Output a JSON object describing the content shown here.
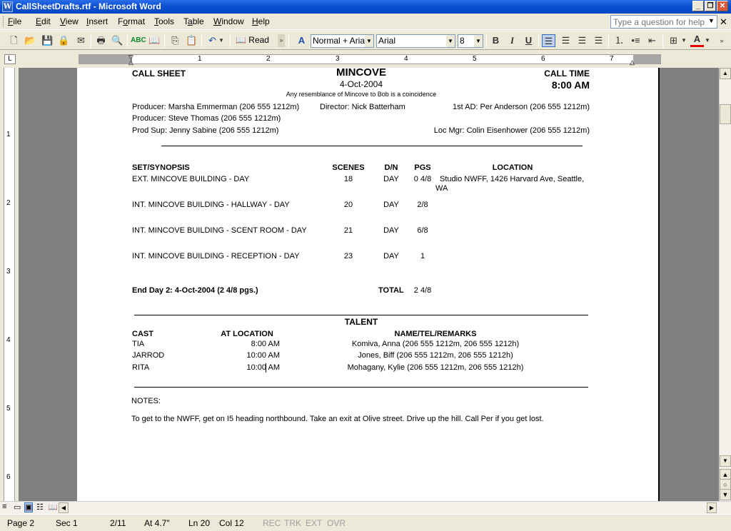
{
  "window": {
    "title": "CallSheetDrafts.rtf - Microsoft Word",
    "app_icon": "W"
  },
  "menu": [
    {
      "label": "File",
      "u": "F"
    },
    {
      "label": "Edit",
      "u": "E"
    },
    {
      "label": "View",
      "u": "V"
    },
    {
      "label": "Insert",
      "u": "I"
    },
    {
      "label": "Format",
      "u": "o"
    },
    {
      "label": "Tools",
      "u": "T"
    },
    {
      "label": "Table",
      "u": "a"
    },
    {
      "label": "Window",
      "u": "W"
    },
    {
      "label": "Help",
      "u": "H"
    }
  ],
  "help": {
    "placeholder": "Type a question for help"
  },
  "toolbar": {
    "read_label": "Read",
    "style": "Normal + Arial,",
    "font": "Arial",
    "size": "8"
  },
  "ruler": {
    "numbers": [
      "1",
      "2",
      "3",
      "4",
      "5",
      "6",
      "7"
    ],
    "vnumbers": [
      "1",
      "2",
      "3",
      "4",
      "5",
      "6"
    ]
  },
  "doc": {
    "call_sheet": "CALL SHEET",
    "title": "MINCOVE",
    "date": "4-Oct-2004",
    "disclaimer": "Any resemblance of Mincove to Bob is a coincidence",
    "call_time_label": "CALL TIME",
    "call_time": "8:00 AM",
    "producer1": "Producer: Marsha Emmerman  (206 555 1212m)",
    "director": "Director: Nick Batterham",
    "ad": "1st AD: Per Anderson  (206 555 1212m)",
    "producer2": "Producer: Steve Thomas  (206 555 1212m)",
    "prodsup": "Prod Sup: Jenny Sabine  (206 555 1212m)",
    "locmgr": "Loc Mgr: Colin Eisenhower  (206 555 1212m)",
    "sched_headers": {
      "set": "SET/SYNOPSIS",
      "scenes": "SCENES",
      "dn": "D/N",
      "pgs": "PGS",
      "location": "LOCATION"
    },
    "scenes": [
      {
        "set": "EXT. MINCOVE BUILDING - DAY",
        "scenes": "18",
        "dn": "DAY",
        "pgs": "0 4/8",
        "loc1": "Studio NWFF, 1426 Harvard Ave, Seattle,",
        "loc2": "WA"
      },
      {
        "set": "INT. MINCOVE BUILDING - HALLWAY - DAY",
        "scenes": "20",
        "dn": "DAY",
        "pgs": "2/8",
        "loc1": "",
        "loc2": ""
      },
      {
        "set": "INT. MINCOVE BUILDING - SCENT ROOM - DAY",
        "scenes": "21",
        "dn": "DAY",
        "pgs": "6/8",
        "loc1": "",
        "loc2": ""
      },
      {
        "set": "INT. MINCOVE BUILDING - RECEPTION - DAY",
        "scenes": "23",
        "dn": "DAY",
        "pgs": "1",
        "loc1": "",
        "loc2": ""
      }
    ],
    "end_day": "End Day 2: 4-Oct-2004 (2 4/8 pgs.)",
    "total_label": "TOTAL",
    "total_value": "2 4/8",
    "talent": "TALENT",
    "cast_headers": {
      "cast": "CAST",
      "atloc": "AT LOCATION",
      "name": "NAME/TEL/REMARKS"
    },
    "cast": [
      {
        "cast": "TIA",
        "time": "8:00 AM",
        "name": "Komiva, Anna (206 555 1212m, 206 555 1212h)"
      },
      {
        "cast": "JARROD",
        "time": "10:00 AM",
        "name": "Jones, Biff (206 555 1212m, 206 555 1212h)"
      },
      {
        "cast": "RITA",
        "time": "10:00 AM",
        "name": "Mohagany, Kylie (206 555 1212m, 206 555 1212h)"
      }
    ],
    "notes_label": "NOTES:",
    "notes": "To get to the NWFF, get on I5 heading northbound.  Take an exit at Olive street.  Drive up the hill.  Call Per if you get lost."
  },
  "status": {
    "page": "Page  2",
    "sec": "Sec  1",
    "pages": "2/11",
    "at": "At  4.7\"",
    "ln": "Ln  20",
    "col": "Col  12",
    "rec": "REC",
    "trk": "TRK",
    "ext": "EXT",
    "ovr": "OVR"
  }
}
